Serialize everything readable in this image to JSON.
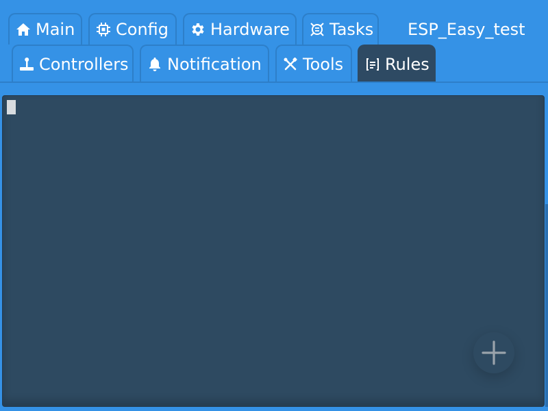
{
  "header": {
    "device_name": "ESP_Easy_test"
  },
  "tabs": [
    {
      "label": "Main",
      "icon": "home-icon"
    },
    {
      "label": "Config",
      "icon": "chip-icon"
    },
    {
      "label": "Hardware",
      "icon": "gear-icon"
    },
    {
      "label": "Tasks",
      "icon": "tasks-icon"
    },
    {
      "label": "Controllers",
      "icon": "joystick-icon"
    },
    {
      "label": "Notification",
      "icon": "bell-icon"
    },
    {
      "label": "Tools",
      "icon": "tools-icon"
    },
    {
      "label": "Rules",
      "icon": "rules-icon",
      "active": true
    }
  ],
  "editor": {
    "content": ""
  },
  "fab": {
    "icon": "plus-icon"
  },
  "colors": {
    "background": "#3592e6",
    "active_tab": "#2e4a63",
    "editor_background": "#2e4a61",
    "text": "#ffffff"
  }
}
